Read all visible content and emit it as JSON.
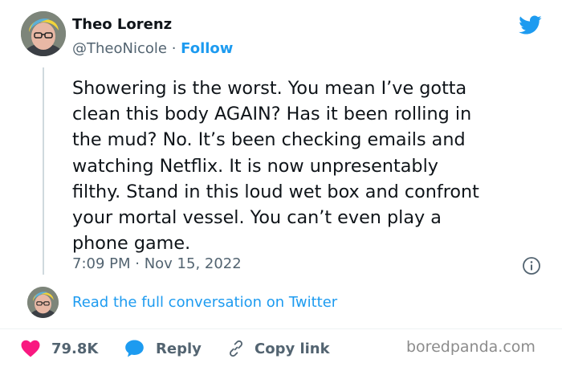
{
  "tweet": {
    "author_name": "Theo Lorenz",
    "handle": "@TheoNicole",
    "separator": "·",
    "follow_label": "Follow",
    "text": "Showering is the worst. You mean I’ve gotta\nclean this body AGAIN? Has it been rolling in\nthe mud? No. It’s been checking emails and\nwatching Netflix. It is now unpresentably\nfilthy. Stand in this loud wet box and confront\nyour mortal vessel. You can’t even play a\nphone game.",
    "timestamp": "7:09 PM · Nov 15, 2022"
  },
  "conversation": {
    "link_text": "Read the full conversation on Twitter"
  },
  "actions": {
    "like_count": "79.8K",
    "reply_label": "Reply",
    "copy_link_label": "Copy link"
  },
  "watermark": "boredpanda.com",
  "icons": {
    "brand": "twitter-bird-icon",
    "info": "info-icon",
    "like": "heart-icon",
    "reply": "speech-bubble-icon",
    "copy": "link-icon"
  },
  "colors": {
    "accent": "#1d9bf0",
    "like": "#f91880",
    "text": "#0f1419",
    "secondary": "#536471",
    "divider": "#eff3f4"
  }
}
